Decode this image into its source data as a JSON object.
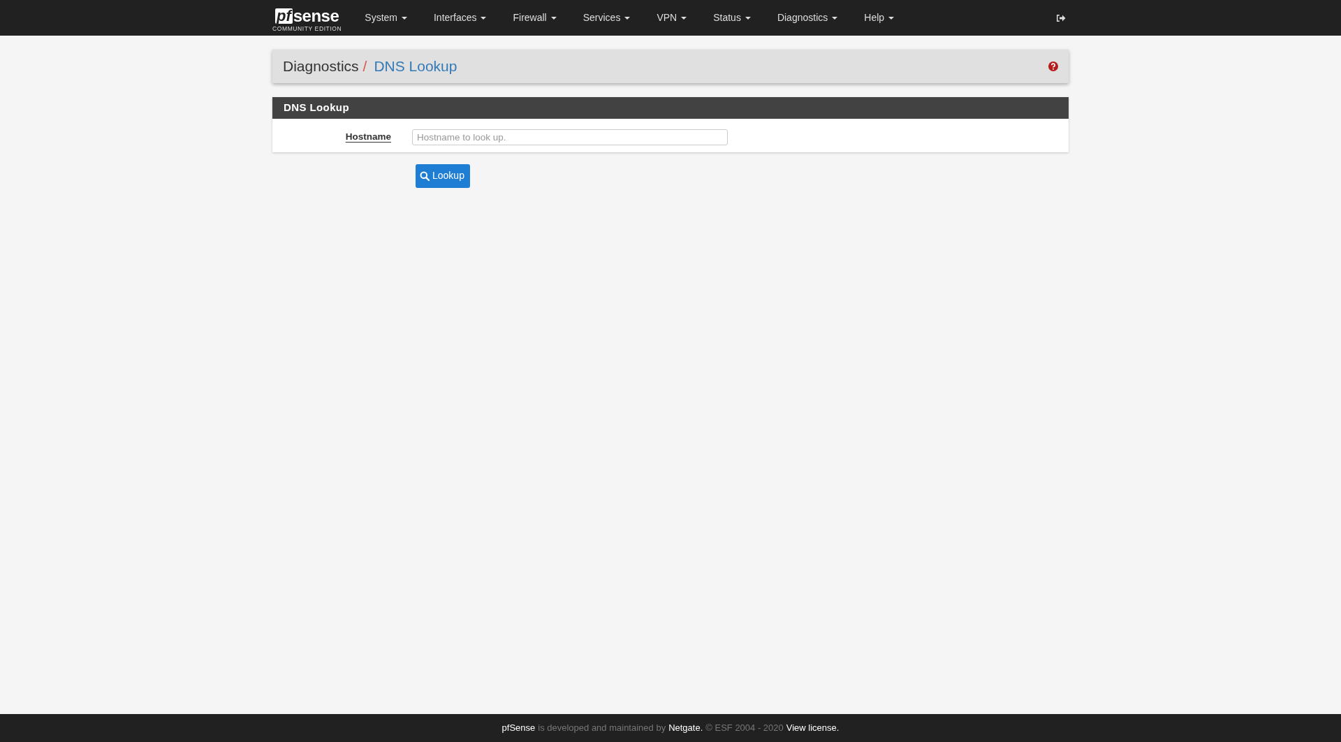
{
  "navbar": {
    "brand": {
      "mark": "pf",
      "name": "sense",
      "edition": "COMMUNITY EDITION"
    },
    "menu": [
      {
        "label": "System"
      },
      {
        "label": "Interfaces"
      },
      {
        "label": "Firewall"
      },
      {
        "label": "Services"
      },
      {
        "label": "VPN"
      },
      {
        "label": "Status"
      },
      {
        "label": "Diagnostics"
      },
      {
        "label": "Help"
      }
    ]
  },
  "breadcrumb": {
    "parent": "Diagnostics",
    "separator": "/",
    "current": "DNS Lookup"
  },
  "panel": {
    "title": "DNS Lookup",
    "fields": [
      {
        "label": "Hostname",
        "placeholder": "Hostname to look up."
      }
    ]
  },
  "buttons": [
    {
      "label": "Lookup"
    }
  ],
  "footer": [
    {
      "text": "pfSense",
      "kind": "link"
    },
    {
      "text": "is developed and maintained by",
      "kind": "text"
    },
    {
      "text": "Netgate.",
      "kind": "link"
    },
    {
      "text": "© ESF 2004 - 2020",
      "kind": "text"
    },
    {
      "text": "View license.",
      "kind": "link"
    }
  ]
}
